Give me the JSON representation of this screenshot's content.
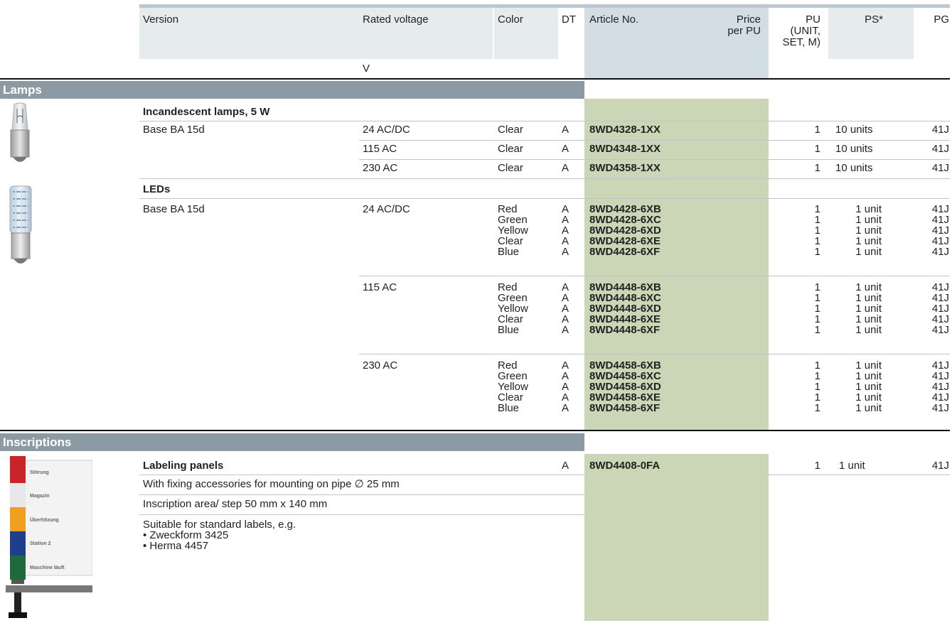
{
  "header": {
    "version": "Version",
    "rated_voltage": "Rated voltage",
    "color": "Color",
    "dt": "DT",
    "article_no": "Article No.",
    "price_line1": "Price",
    "price_line2": "per PU",
    "pu_line1": "PU",
    "pu_line2": "(UNIT,",
    "pu_line3": "SET, M)",
    "ps": "PS*",
    "pg": "PG",
    "unit_v": "V"
  },
  "sections": {
    "lamps": "Lamps",
    "inscriptions": "Inscriptions"
  },
  "incandescent": {
    "title": "Incandescent lamps, 5 W",
    "version": "Base BA 15d",
    "rows": [
      {
        "voltage": "24 AC/DC",
        "color": "Clear",
        "dt": "A",
        "article": "8WD4328-1XX",
        "pu": "1",
        "ps": "10 units",
        "pg": "41J"
      },
      {
        "voltage": "115 AC",
        "color": "Clear",
        "dt": "A",
        "article": "8WD4348-1XX",
        "pu": "1",
        "ps": "10 units",
        "pg": "41J"
      },
      {
        "voltage": "230 AC",
        "color": "Clear",
        "dt": "A",
        "article": "8WD4358-1XX",
        "pu": "1",
        "ps": "10 units",
        "pg": "41J"
      }
    ]
  },
  "leds": {
    "title": "LEDs",
    "version": "Base BA 15d",
    "groups": [
      {
        "voltage": "24 AC/DC",
        "items": [
          {
            "color": "Red",
            "dt": "A",
            "article": "8WD4428-6XB",
            "pu": "1",
            "ps": "1 unit",
            "pg": "41J"
          },
          {
            "color": "Green",
            "dt": "A",
            "article": "8WD4428-6XC",
            "pu": "1",
            "ps": "1 unit",
            "pg": "41J"
          },
          {
            "color": "Yellow",
            "dt": "A",
            "article": "8WD4428-6XD",
            "pu": "1",
            "ps": "1 unit",
            "pg": "41J"
          },
          {
            "color": "Clear",
            "dt": "A",
            "article": "8WD4428-6XE",
            "pu": "1",
            "ps": "1 unit",
            "pg": "41J"
          },
          {
            "color": "Blue",
            "dt": "A",
            "article": "8WD4428-6XF",
            "pu": "1",
            "ps": "1 unit",
            "pg": "41J"
          }
        ]
      },
      {
        "voltage": "115 AC",
        "items": [
          {
            "color": "Red",
            "dt": "A",
            "article": "8WD4448-6XB",
            "pu": "1",
            "ps": "1 unit",
            "pg": "41J"
          },
          {
            "color": "Green",
            "dt": "A",
            "article": "8WD4448-6XC",
            "pu": "1",
            "ps": "1 unit",
            "pg": "41J"
          },
          {
            "color": "Yellow",
            "dt": "A",
            "article": "8WD4448-6XD",
            "pu": "1",
            "ps": "1 unit",
            "pg": "41J"
          },
          {
            "color": "Clear",
            "dt": "A",
            "article": "8WD4448-6XE",
            "pu": "1",
            "ps": "1 unit",
            "pg": "41J"
          },
          {
            "color": "Blue",
            "dt": "A",
            "article": "8WD4448-6XF",
            "pu": "1",
            "ps": "1 unit",
            "pg": "41J"
          }
        ]
      },
      {
        "voltage": "230 AC",
        "items": [
          {
            "color": "Red",
            "dt": "A",
            "article": "8WD4458-6XB",
            "pu": "1",
            "ps": "1 unit",
            "pg": "41J"
          },
          {
            "color": "Green",
            "dt": "A",
            "article": "8WD4458-6XC",
            "pu": "1",
            "ps": "1 unit",
            "pg": "41J"
          },
          {
            "color": "Yellow",
            "dt": "A",
            "article": "8WD4458-6XD",
            "pu": "1",
            "ps": "1 unit",
            "pg": "41J"
          },
          {
            "color": "Clear",
            "dt": "A",
            "article": "8WD4458-6XE",
            "pu": "1",
            "ps": "1 unit",
            "pg": "41J"
          },
          {
            "color": "Blue",
            "dt": "A",
            "article": "8WD4458-6XF",
            "pu": "1",
            "ps": "1 unit",
            "pg": "41J"
          }
        ]
      }
    ]
  },
  "labeling": {
    "title": "Labeling panels",
    "dt": "A",
    "article": "8WD4408-0FA",
    "pu": "1",
    "ps": "1 unit",
    "pg": "41J",
    "desc1": "With fixing accessories for mounting on pipe ∅ 25 mm",
    "desc2": "Inscription area/ step 50 mm x 140 mm",
    "desc3": "Suitable for standard labels, e.g.",
    "bullet1": "• Zweckform 3425",
    "bullet2": "• Herma 4457",
    "panel_labels": [
      "Störung",
      "Magazin",
      "Überhitzung",
      "Station 2",
      "Maschine läuft"
    ]
  },
  "colors": {
    "section_band": "#8c9aa4",
    "article_column": "#cbd6b6",
    "header_fill": "#e6ebee"
  }
}
